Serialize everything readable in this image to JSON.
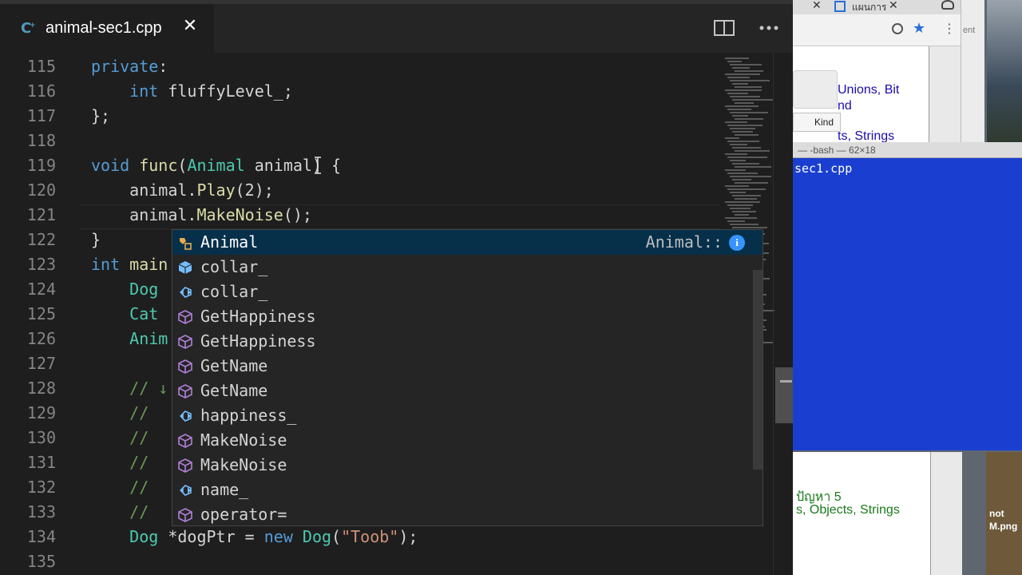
{
  "editor": {
    "tab": {
      "title": "animal-sec1.cpp",
      "close": "✕",
      "icon": "cpp-file-icon"
    },
    "lines": [
      {
        "n": "115",
        "tokens": [
          [
            "kw",
            "private"
          ],
          [
            "p",
            ":"
          ]
        ]
      },
      {
        "n": "116",
        "tokens": [
          [
            "p",
            "    "
          ],
          [
            "kw",
            "int"
          ],
          [
            "p",
            " fluffyLevel_;"
          ]
        ]
      },
      {
        "n": "117",
        "tokens": [
          [
            "p",
            "};"
          ]
        ]
      },
      {
        "n": "118",
        "tokens": []
      },
      {
        "n": "119",
        "tokens": [
          [
            "kw",
            "void"
          ],
          [
            "p",
            " "
          ],
          [
            "fn",
            "func"
          ],
          [
            "p",
            "("
          ],
          [
            "ty",
            "Animal"
          ],
          [
            "p",
            " animal) {"
          ]
        ]
      },
      {
        "n": "120",
        "tokens": [
          [
            "p",
            "    animal."
          ],
          [
            "fn",
            "Play"
          ],
          [
            "p",
            "(2);"
          ]
        ]
      },
      {
        "n": "121",
        "tokens": [
          [
            "p",
            "    animal."
          ],
          [
            "fn",
            "MakeNoise"
          ],
          [
            "p",
            "();"
          ]
        ]
      },
      {
        "n": "122",
        "tokens": [
          [
            "p",
            "}"
          ]
        ]
      },
      {
        "n": "123",
        "tokens": [
          [
            "kw",
            "int"
          ],
          [
            "p",
            " "
          ],
          [
            "fn",
            "main"
          ]
        ]
      },
      {
        "n": "124",
        "tokens": [
          [
            "p",
            "    "
          ],
          [
            "ty",
            "Dog"
          ]
        ]
      },
      {
        "n": "125",
        "tokens": [
          [
            "p",
            "    "
          ],
          [
            "ty",
            "Cat"
          ]
        ]
      },
      {
        "n": "126",
        "tokens": [
          [
            "p",
            "    "
          ],
          [
            "ty",
            "Anim"
          ]
        ]
      },
      {
        "n": "127",
        "tokens": []
      },
      {
        "n": "128",
        "tokens": [
          [
            "p",
            "    "
          ],
          [
            "cm",
            "// ↓"
          ]
        ]
      },
      {
        "n": "129",
        "tokens": [
          [
            "p",
            "    "
          ],
          [
            "cm",
            "//"
          ]
        ]
      },
      {
        "n": "130",
        "tokens": [
          [
            "p",
            "    "
          ],
          [
            "cm",
            "//"
          ]
        ]
      },
      {
        "n": "131",
        "tokens": [
          [
            "p",
            "    "
          ],
          [
            "cm",
            "//"
          ]
        ]
      },
      {
        "n": "132",
        "tokens": [
          [
            "p",
            "    "
          ],
          [
            "cm",
            "//"
          ]
        ]
      },
      {
        "n": "133",
        "tokens": [
          [
            "p",
            "    "
          ],
          [
            "cm",
            "//"
          ]
        ]
      },
      {
        "n": "134",
        "tokens": [
          [
            "p",
            "    "
          ],
          [
            "ty",
            "Dog"
          ],
          [
            "p",
            " *dogPtr = "
          ],
          [
            "kw",
            "new"
          ],
          [
            "p",
            " "
          ],
          [
            "ty",
            "Dog"
          ],
          [
            "p",
            "("
          ],
          [
            "str",
            "\"Toob\""
          ],
          [
            "p",
            ");"
          ]
        ]
      },
      {
        "n": "135",
        "tokens": []
      }
    ]
  },
  "suggest": {
    "selected_detail": "Animal::",
    "info": "i",
    "items": [
      {
        "label": "Animal",
        "kind": "class",
        "selected": true
      },
      {
        "label": "collar_",
        "kind": "cube"
      },
      {
        "label": "collar_",
        "kind": "field"
      },
      {
        "label": "GetHappiness",
        "kind": "method"
      },
      {
        "label": "GetHappiness",
        "kind": "method"
      },
      {
        "label": "GetName",
        "kind": "method"
      },
      {
        "label": "GetName",
        "kind": "method"
      },
      {
        "label": "happiness_",
        "kind": "field"
      },
      {
        "label": "MakeNoise",
        "kind": "method"
      },
      {
        "label": "MakeNoise",
        "kind": "method"
      },
      {
        "label": "name_",
        "kind": "field"
      },
      {
        "label": "operator=",
        "kind": "method"
      }
    ]
  },
  "background": {
    "chrome_tab_close_1": "✕",
    "chrome_tab_title": "แผนการ",
    "chrome_tab_close_2": "✕",
    "side_text": "ent",
    "page_links": [
      "Unions, Bit",
      "nd",
      "ts, Strings"
    ],
    "kind_button": "Kind",
    "terminal_title": "— -bash — 62×18",
    "terminal_text": "sec1.cpp",
    "bottom_links": [
      "ปัญหา 5",
      "s, Objects, Strings"
    ],
    "desktop_labels": [
      "not",
      "M.png"
    ]
  }
}
